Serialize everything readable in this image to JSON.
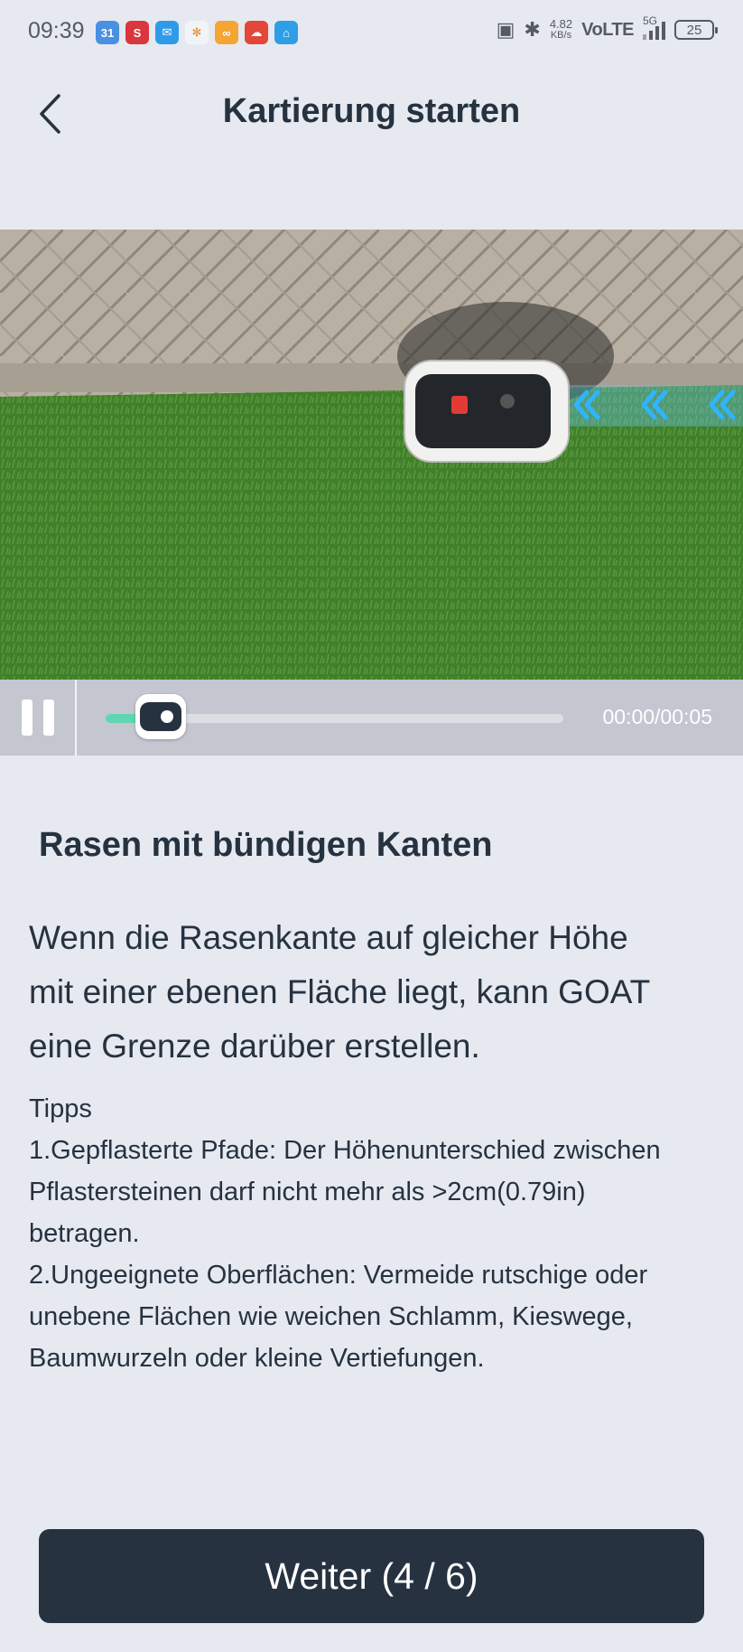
{
  "status_bar": {
    "time": "09:39",
    "notification_icons": [
      {
        "name": "calendar-icon",
        "glyph": "31",
        "color": "#4a90e2"
      },
      {
        "name": "s-app-icon",
        "glyph": "S",
        "color": "#d9363e"
      },
      {
        "name": "mail-icon",
        "glyph": "✉",
        "color": "#2f9be8"
      },
      {
        "name": "pinwheel-icon",
        "glyph": "✻",
        "color": "#f2f3f6"
      },
      {
        "name": "link-app-icon",
        "glyph": "∞",
        "color": "#f4a533"
      },
      {
        "name": "cloud-app-icon",
        "glyph": "☁",
        "color": "#e2473a"
      },
      {
        "name": "home-app-icon",
        "glyph": "⌂",
        "color": "#2e9fe6"
      }
    ],
    "net_speed_value": "4.82",
    "net_speed_unit": "KB/s",
    "network_label": "VoLTE",
    "signal_label": "5G",
    "battery_level": "25"
  },
  "header": {
    "title": "Kartierung starten"
  },
  "video": {
    "time_display": "00:00/00:05",
    "progress": 0.12
  },
  "content": {
    "section_title": "Rasen mit bündigen Kanten",
    "lead_lines": [
      "Wenn die Rasenkante auf gleicher Höhe",
      "mit einer ebenen Fläche liegt, kann GOAT",
      "eine Grenze darüber erstellen."
    ],
    "tips_lines": [
      "Tipps",
      "1.Gepflasterte Pfade: Der Höhenunterschied zwischen",
      "Pflastersteinen darf nicht mehr als >2cm(0.79in)",
      "betragen.",
      "2.Ungeeignete Oberflächen: Vermeide rutschige oder",
      "unebene Flächen wie weichen Schlamm, Kieswege,",
      "Baumwurzeln oder kleine Vertiefungen."
    ]
  },
  "footer": {
    "next_label": "Weiter (4 / 6)"
  },
  "colors": {
    "background": "#e6e9f0",
    "text_dark": "#26323f",
    "button_bg": "#26323f",
    "progress_accent": "#5fd6b1"
  }
}
